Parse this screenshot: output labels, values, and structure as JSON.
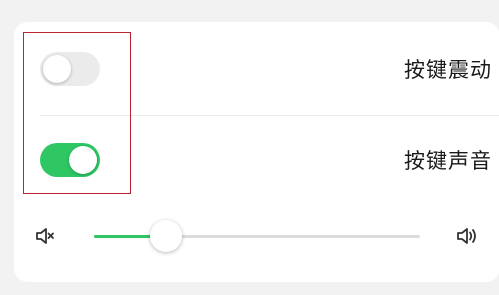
{
  "settings": {
    "vibrate": {
      "label": "按键震动",
      "enabled": false
    },
    "sound": {
      "label": "按键声音",
      "enabled": true
    },
    "volume": {
      "level": 0.22,
      "min_icon": "volume-mute-icon",
      "max_icon": "volume-loud-icon"
    }
  },
  "colors": {
    "accent": "#2ec764",
    "highlight_box": "#b8252e",
    "switch_off": "#ebebeb",
    "track": "#dcdcdc"
  }
}
